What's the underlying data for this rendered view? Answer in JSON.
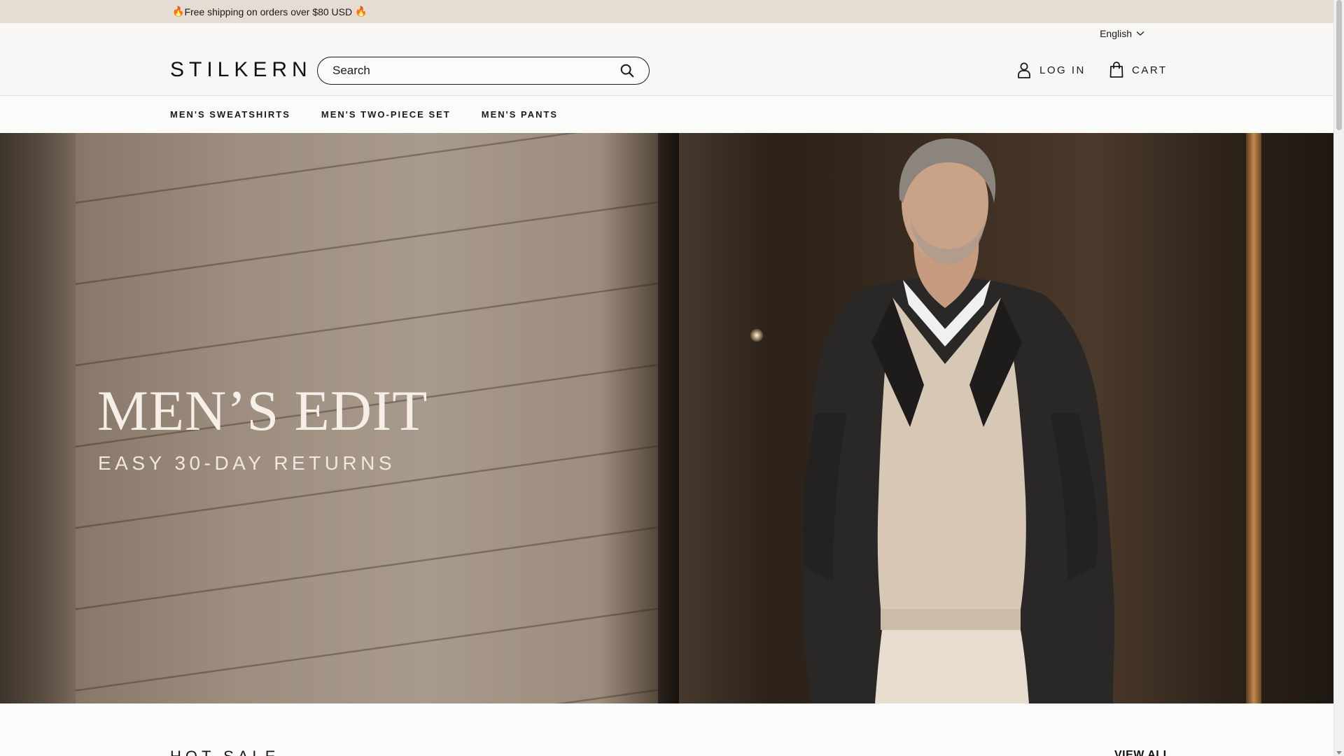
{
  "announcement": {
    "fire_left": "🔥",
    "text": "Free shipping on orders over $80 USD",
    "fire_right": "🔥"
  },
  "header": {
    "language": "English",
    "logo": "STILKERN",
    "search_placeholder": "Search",
    "login_label": "LOG IN",
    "cart_label": "CART"
  },
  "nav": {
    "items": [
      {
        "label": "MEN'S SWEATSHIRTS"
      },
      {
        "label": "MEN'S TWO-PIECE SET"
      },
      {
        "label": "MEN'S PANTS"
      }
    ]
  },
  "hero": {
    "title": "MEN’S EDIT",
    "subtitle": "EASY 30-DAY RETURNS"
  },
  "hot_sale": {
    "title": "HOT SALE",
    "view_all": "VIEW ALL"
  },
  "colors": {
    "announcement_bg": "#e5ddd3",
    "header_bg": "#f8f7f6",
    "text": "#1a1a1a",
    "hero_text": "#f5efe7"
  }
}
